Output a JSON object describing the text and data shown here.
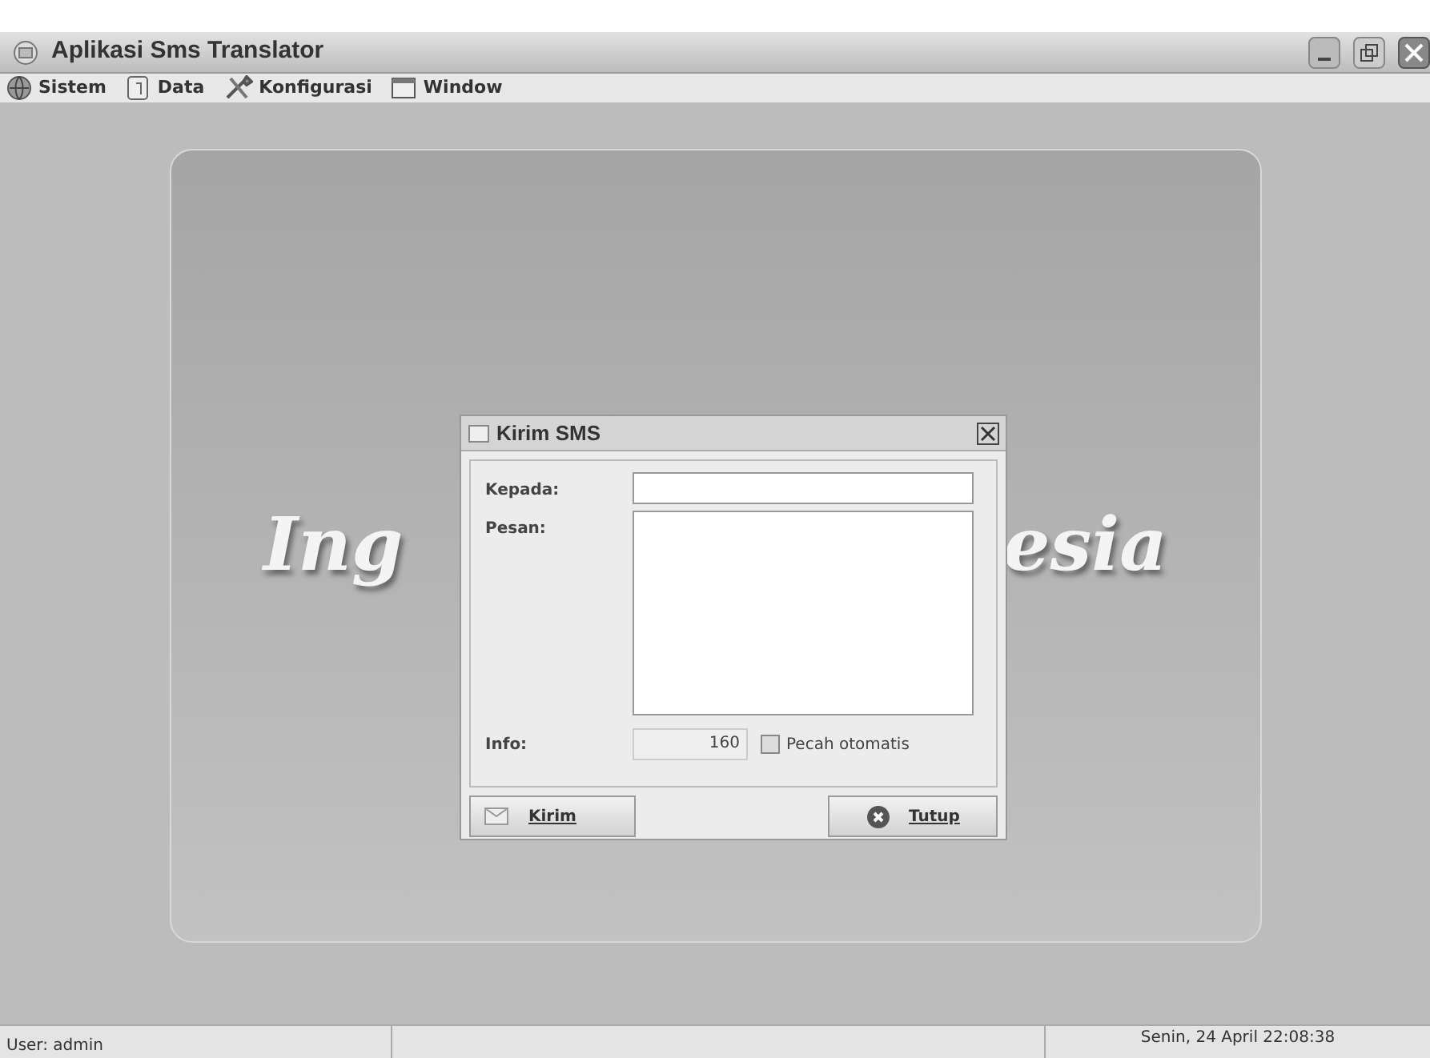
{
  "window": {
    "title": "Aplikasi Sms Translator"
  },
  "menu": [
    {
      "label": "Sistem"
    },
    {
      "label": "Data"
    },
    {
      "label": "Konfigurasi"
    },
    {
      "label": "Window"
    }
  ],
  "background_logo": {
    "left": "Ing",
    "right": "esia"
  },
  "dialog": {
    "title": "Kirim SMS",
    "fields": [
      {
        "label": "Kepada:",
        "kind": "line"
      },
      {
        "label": "Pesan:",
        "kind": "area"
      }
    ],
    "info": {
      "label": "Info:",
      "value": "160"
    },
    "checkbox": {
      "label": "Pecah otomatis",
      "checked": false
    },
    "buttons": [
      {
        "label": "Kirim",
        "kind": "send"
      },
      {
        "label": "Tutup",
        "kind": "close"
      }
    ]
  },
  "status_bar": {
    "user": "User: admin",
    "datetime": "Senin, 24 April 22:08:38"
  }
}
